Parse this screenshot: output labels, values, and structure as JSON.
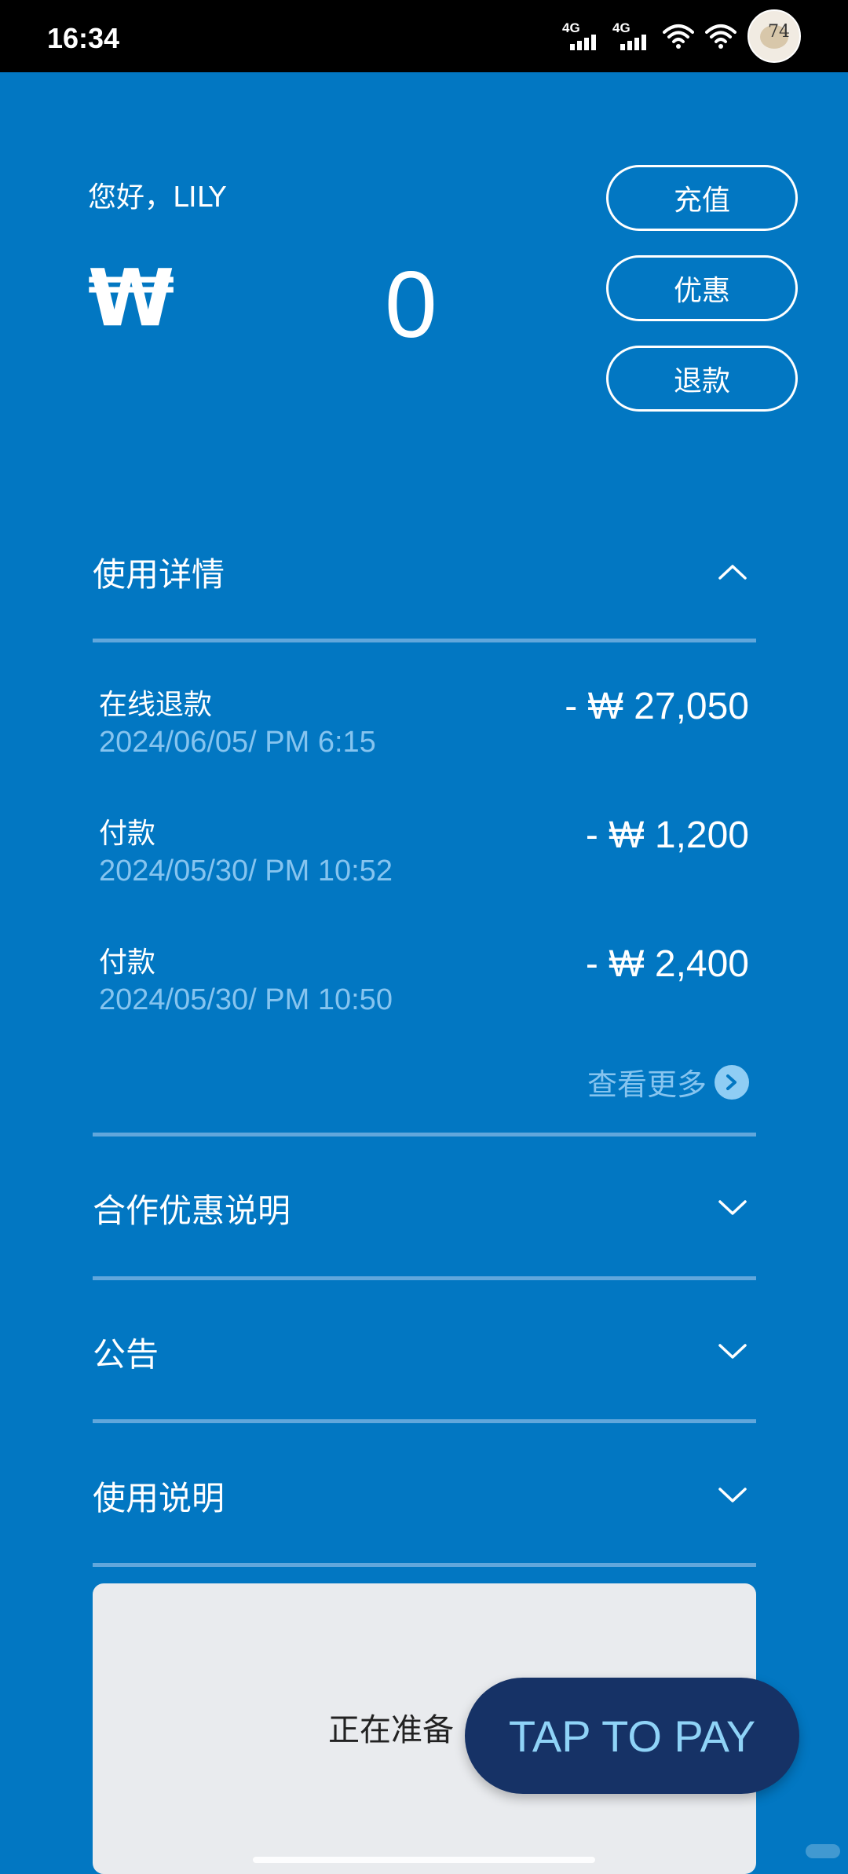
{
  "status_bar": {
    "time": "16:34",
    "network_1": "4G",
    "network_2": "4G",
    "avatar_text": "74"
  },
  "account": {
    "greeting": "您好，LILY",
    "currency_symbol": "₩",
    "balance": "0"
  },
  "actions": {
    "recharge_label": "充值",
    "discount_label": "优惠",
    "refund_label": "退款"
  },
  "usage_details": {
    "title": "使用详情",
    "expanded": true,
    "transactions": [
      {
        "type": "在线退款",
        "date": "2024/06/05/ PM 6:15",
        "amount": "- ₩ 27,050"
      },
      {
        "type": "付款",
        "date": "2024/05/30/ PM 10:52",
        "amount": "- ₩ 1,200"
      },
      {
        "type": "付款",
        "date": "2024/05/30/ PM 10:50",
        "amount": "- ₩ 2,400"
      }
    ],
    "view_more_label": "查看更多"
  },
  "sections": [
    {
      "title": "合作优惠说明",
      "expanded": false
    },
    {
      "title": "公告",
      "expanded": false
    },
    {
      "title": "使用说明",
      "expanded": false
    }
  ],
  "payment_card": {
    "status_text": "正在准备",
    "tap_to_pay_label": "TAP TO PAY"
  },
  "colors": {
    "background": "#0277c2",
    "divider": "#61a7dc",
    "secondary_text": "#86c4ef",
    "tap_button": "#163266",
    "tap_button_text": "#8fd3f7",
    "card": "#e9ebee"
  },
  "icons": {
    "section_expanded": "chevron-up-icon",
    "section_collapsed": "chevron-down-icon",
    "view_more": "chevron-right-circle-icon"
  }
}
